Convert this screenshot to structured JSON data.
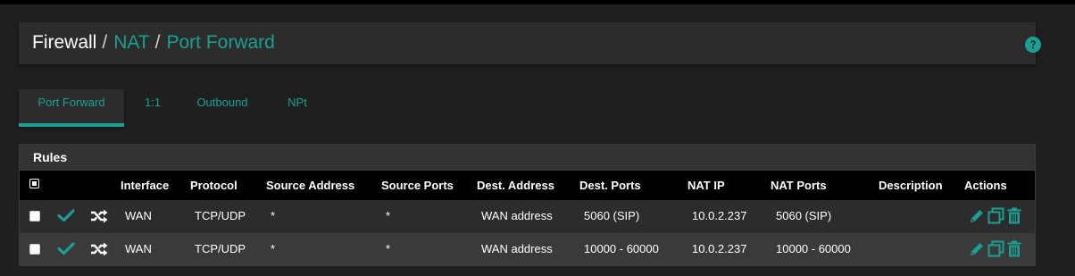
{
  "breadcrumb": {
    "items": [
      "Firewall",
      "NAT",
      "Port Forward"
    ],
    "separator": "/"
  },
  "help_icon": "question-circle-icon",
  "tabs": [
    {
      "label": "Port Forward",
      "active": true
    },
    {
      "label": "1:1",
      "active": false
    },
    {
      "label": "Outbound",
      "active": false
    },
    {
      "label": "NPt",
      "active": false
    }
  ],
  "rules": {
    "title": "Rules",
    "columns": [
      "Interface",
      "Protocol",
      "Source Address",
      "Source Ports",
      "Dest. Address",
      "Dest. Ports",
      "NAT IP",
      "NAT Ports",
      "Description",
      "Actions"
    ],
    "rows": [
      {
        "checked": false,
        "status_icon": "check-icon",
        "type_icon": "random-shuffle-icon",
        "interface": "WAN",
        "protocol": "TCP/UDP",
        "source_address": "*",
        "source_ports": "*",
        "dest_address": "WAN address",
        "dest_ports": "5060 (SIP)",
        "nat_ip": "10.0.2.237",
        "nat_ports": "5060 (SIP)",
        "description": "",
        "actions": [
          "edit-pencil-icon",
          "copy-clone-icon",
          "delete-trash-icon"
        ]
      },
      {
        "checked": false,
        "status_icon": "check-icon",
        "type_icon": "random-shuffle-icon",
        "interface": "WAN",
        "protocol": "TCP/UDP",
        "source_address": "*",
        "source_ports": "*",
        "dest_address": "WAN address",
        "dest_ports": "10000 - 60000",
        "nat_ip": "10.0.2.237",
        "nat_ports": "10000 - 60000",
        "description": "",
        "actions": [
          "edit-pencil-icon",
          "copy-clone-icon",
          "delete-trash-icon"
        ]
      }
    ]
  },
  "colors": {
    "accent": "#19a093",
    "background": "#1f1f1f",
    "panel": "#2c2c2c",
    "table_header": "#000000",
    "row_alt": "#3a3a3a"
  }
}
